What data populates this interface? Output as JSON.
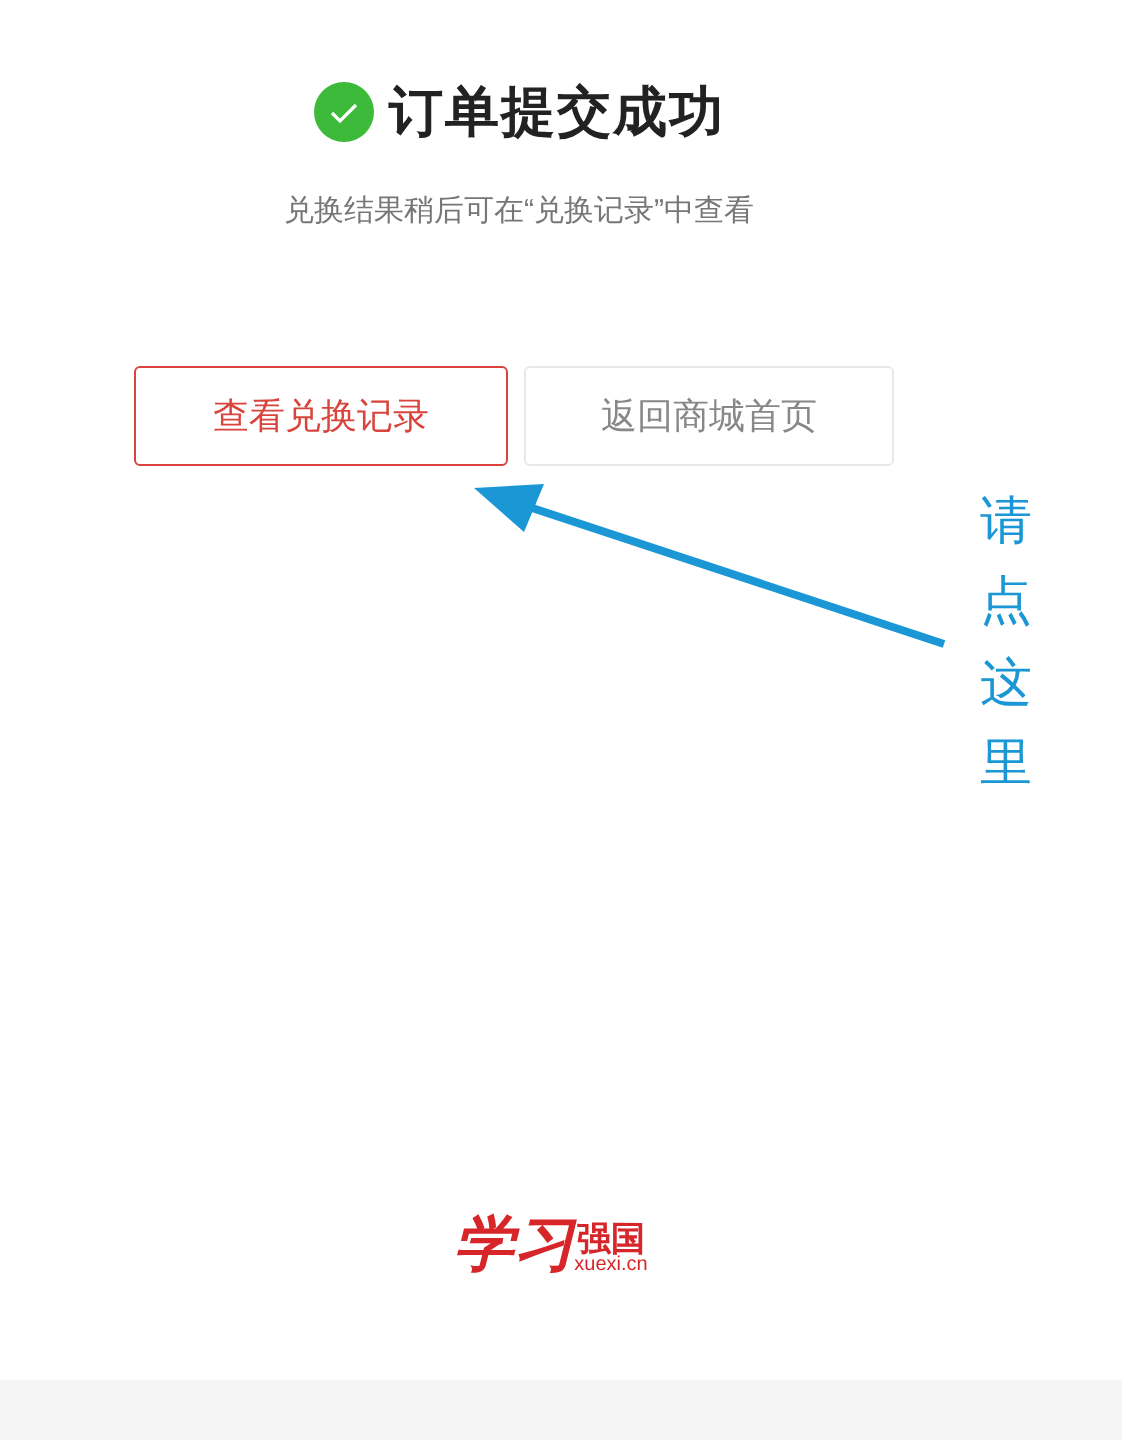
{
  "header": {
    "title": "订单提交成功",
    "subtitle": "兑换结果稍后可在“兑换记录”中查看"
  },
  "buttons": [
    {
      "label": "查看兑换记录",
      "kind": "primary"
    },
    {
      "label": "返回商城首页",
      "kind": "secondary"
    }
  ],
  "annotation": {
    "text": "请点这里"
  },
  "footer_logo": {
    "calligraphy": "学习",
    "name": "强国",
    "domain": "xuexi.cn"
  }
}
